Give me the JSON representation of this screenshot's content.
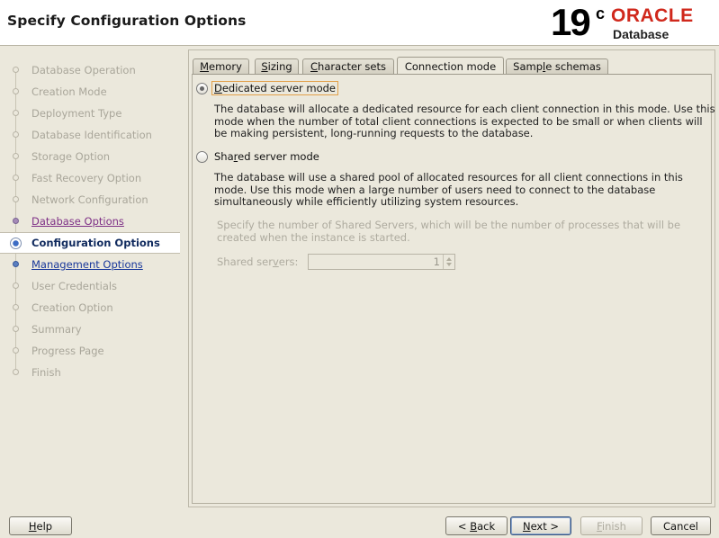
{
  "header": {
    "title": "Specify Configuration Options",
    "logo": {
      "version": "19",
      "version_sup": "c",
      "brand": "ORACLE",
      "product": "Database"
    }
  },
  "nav": {
    "steps": [
      {
        "label": "Database Operation",
        "state": "pending"
      },
      {
        "label": "Creation Mode",
        "state": "pending"
      },
      {
        "label": "Deployment Type",
        "state": "pending"
      },
      {
        "label": "Database Identification",
        "state": "pending"
      },
      {
        "label": "Storage Option",
        "state": "pending"
      },
      {
        "label": "Fast Recovery Option",
        "state": "pending"
      },
      {
        "label": "Network Configuration",
        "state": "pending"
      },
      {
        "label": "Database Options",
        "state": "visited"
      },
      {
        "label": "Configuration Options",
        "state": "current"
      },
      {
        "label": "Management Options",
        "state": "next"
      },
      {
        "label": "User Credentials",
        "state": "pending"
      },
      {
        "label": "Creation Option",
        "state": "pending"
      },
      {
        "label": "Summary",
        "state": "pending"
      },
      {
        "label": "Progress Page",
        "state": "pending"
      },
      {
        "label": "Finish",
        "state": "pending"
      }
    ]
  },
  "tabs": {
    "items": [
      {
        "pre": "",
        "mn": "M",
        "post": "emory"
      },
      {
        "pre": "",
        "mn": "S",
        "post": "izing"
      },
      {
        "pre": "",
        "mn": "C",
        "post": "haracter sets"
      },
      {
        "pre": "Connection mode",
        "mn": "",
        "post": ""
      },
      {
        "pre": "Samp",
        "mn": "l",
        "post": "e schemas"
      }
    ],
    "active_index": 3
  },
  "connection_mode": {
    "dedicated": {
      "label_pre": "",
      "label_mn": "D",
      "label_post": "edicated server mode",
      "selected": true,
      "description": "The database will allocate a dedicated resource for each client connection in this mode. Use this mode when the number of total client connections is expected to be small or when clients will be making persistent, long-running requests to the database."
    },
    "shared": {
      "label_pre": "Sha",
      "label_mn": "r",
      "label_post": "ed server mode",
      "selected": false,
      "description": "The database will use a shared pool of allocated resources for all client connections in this mode.  Use this mode when a large number of users need to connect to the database simultaneously while efficiently utilizing system resources.",
      "servers_hint": "Specify the number of Shared Servers, which will be the number of processes that will be created when the instance is started.",
      "servers_label_pre": "Shared ser",
      "servers_label_mn": "v",
      "servers_label_post": "ers:",
      "servers_value": "1"
    }
  },
  "buttons": {
    "help": {
      "pre": "",
      "mn": "H",
      "post": "elp"
    },
    "back": {
      "pre": "< ",
      "mn": "B",
      "post": "ack"
    },
    "next": {
      "pre": "",
      "mn": "N",
      "post": "ext >"
    },
    "finish": {
      "pre": "",
      "mn": "F",
      "post": "inish"
    },
    "cancel": {
      "pre": "Cancel",
      "mn": "",
      "post": ""
    }
  }
}
